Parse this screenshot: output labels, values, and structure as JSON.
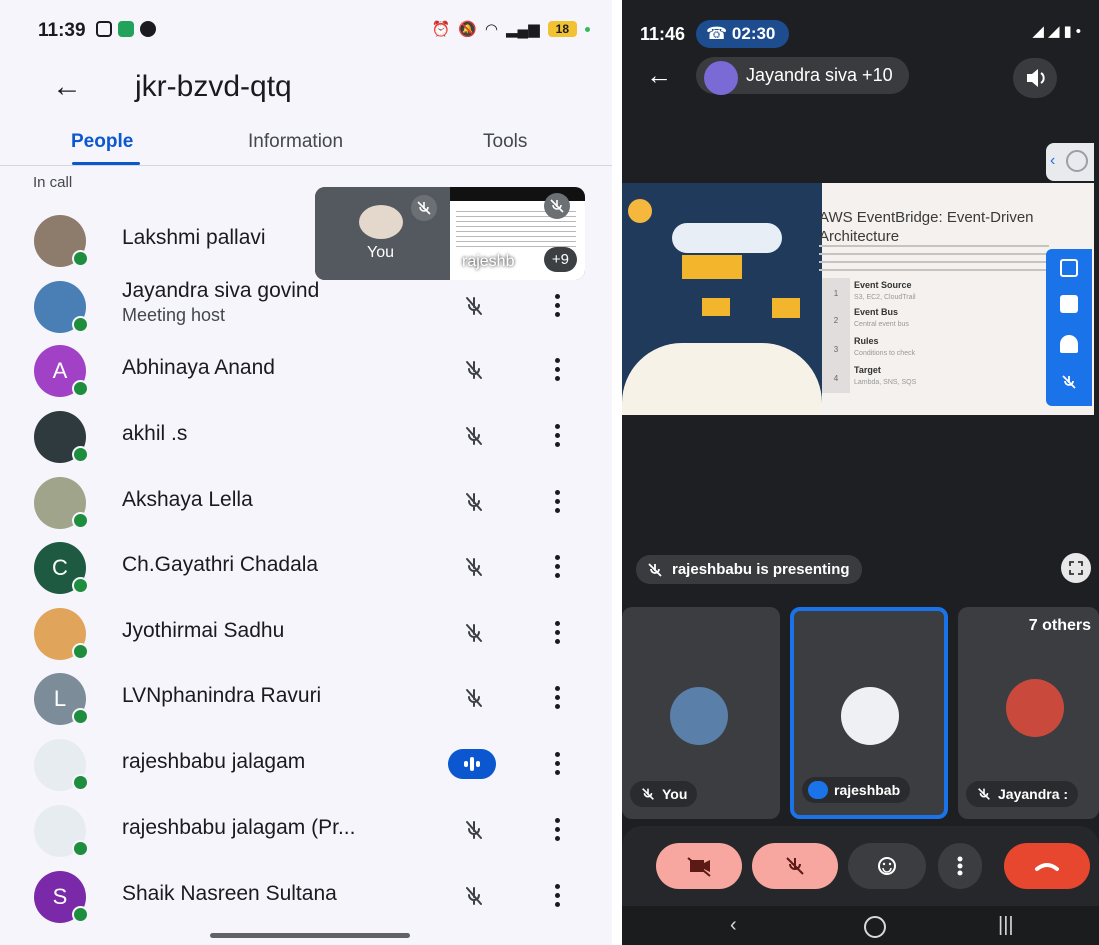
{
  "left_status": {
    "time": "11:39",
    "battery": "18"
  },
  "header": {
    "back": "←",
    "title": "jkr-bzvd-qtq"
  },
  "tabs": [
    {
      "label": "People",
      "active": true
    },
    {
      "label": "Information",
      "active": false
    },
    {
      "label": "Tools",
      "active": false
    }
  ],
  "section_label": "In call",
  "participants": [
    {
      "name": "Lakshmi pallavi",
      "initial": "",
      "avatar_color": "#8d7b6b",
      "mic": "muted"
    },
    {
      "name": "Jayandra siva govind",
      "sub": "Meeting host",
      "initial": "",
      "avatar_color": "#4a7fb5",
      "mic": "muted"
    },
    {
      "name": "Abhinaya Anand",
      "initial": "A",
      "avatar_color": "#a142c6",
      "mic": "muted"
    },
    {
      "name": "akhil .s",
      "initial": "",
      "avatar_color": "#2f3a3f",
      "mic": "muted"
    },
    {
      "name": "Akshaya Lella",
      "initial": "",
      "avatar_color": "#9fa48a",
      "mic": "muted"
    },
    {
      "name": "Ch.Gayathri Chadala",
      "initial": "C",
      "avatar_color": "#1d5a41",
      "mic": "muted"
    },
    {
      "name": "Jyothirmai Sadhu",
      "initial": "",
      "avatar_color": "#e0a55a",
      "mic": "muted"
    },
    {
      "name": "LVNphanindra Ravuri",
      "initial": "L",
      "avatar_color": "#7d8c99",
      "mic": "muted"
    },
    {
      "name": "rajeshbabu jalagam",
      "initial": "",
      "avatar_color": "#e7ecf1",
      "mic": "speaking"
    },
    {
      "name": "rajeshbabu jalagam (Pr...",
      "initial": "",
      "avatar_color": "#e7ecf1",
      "mic": "muted"
    },
    {
      "name": "Shaik Nasreen Sultana",
      "initial": "S",
      "avatar_color": "#7a2aa8",
      "mic": "muted"
    }
  ],
  "pip": {
    "you_label": "You",
    "share_label": "rajeshb",
    "more_count": "+9"
  },
  "right_status": {
    "time": "11:46",
    "call_timer": "02:30"
  },
  "call_header": {
    "chip_label": "Jayandra siva +10"
  },
  "slide": {
    "title": "AWS EventBridge: Event-Driven Architecture",
    "steps": [
      {
        "num": "1",
        "title": "Event Source",
        "sub": "S3, EC2, CloudTrail"
      },
      {
        "num": "2",
        "title": "Event Bus",
        "sub": "Central event bus"
      },
      {
        "num": "3",
        "title": "Rules",
        "sub": "Conditions to check"
      },
      {
        "num": "4",
        "title": "Target",
        "sub": "Lambda, SNS, SQS"
      }
    ]
  },
  "presenting_label": "rajeshbabu is presenting",
  "tiles": [
    {
      "label": "You"
    },
    {
      "label": "rajeshbab"
    },
    {
      "label": "Jayandra :",
      "others": "7 others"
    }
  ],
  "colors": {
    "accent": "#0b57d0",
    "online": "#1e8e3e",
    "end_call": "#e8472f",
    "muted_btn": "#f7a7a0"
  }
}
